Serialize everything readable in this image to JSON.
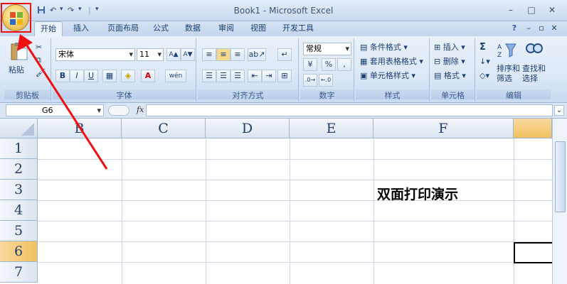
{
  "window": {
    "title": "Book1 - Microsoft Excel"
  },
  "quick_access": {
    "undo": "↶",
    "redo": "↷",
    "separator": "|",
    "more": "▾"
  },
  "window_controls": {
    "minimize": "–",
    "maximize": "□",
    "close": "✕"
  },
  "tabs": [
    {
      "label": "开始",
      "active": true
    },
    {
      "label": "插入"
    },
    {
      "label": "页面布局"
    },
    {
      "label": "公式"
    },
    {
      "label": "数据"
    },
    {
      "label": "审阅"
    },
    {
      "label": "视图"
    },
    {
      "label": "开发工具"
    }
  ],
  "ribbon_controls": {
    "help": "?",
    "minimize": "–",
    "restore": "▫",
    "close": "✕"
  },
  "ribbon": {
    "clipboard": {
      "paste": "粘贴",
      "label": "剪贴板"
    },
    "font": {
      "name": "宋体",
      "size": "11",
      "grow": "A▲",
      "shrink": "A▼",
      "bold": "B",
      "italic": "I",
      "underline": "U",
      "wen": "wén",
      "label": "字体"
    },
    "alignment": {
      "label": "对齐方式"
    },
    "number": {
      "format": "常规",
      "percent": "%",
      "comma": ",",
      "label": "数字"
    },
    "styles": {
      "conditional": "条件格式",
      "table": "套用表格格式",
      "cell": "单元格样式",
      "label": "样式"
    },
    "cells": {
      "insert": "插入",
      "delete": "删除",
      "format": "格式",
      "label": "单元格"
    },
    "editing": {
      "sigma": "Σ",
      "sort": "排序和",
      "filter": "筛选",
      "find": "查找和",
      "select": "选择",
      "label": "编辑"
    }
  },
  "formula_bar": {
    "name_box": "G6",
    "fx": "fx",
    "value": ""
  },
  "columns": [
    "B",
    "C",
    "D",
    "E",
    "F"
  ],
  "rows": [
    "1",
    "2",
    "3",
    "4",
    "5",
    "6",
    "7"
  ],
  "cells": {
    "F3": "双面打印演示"
  },
  "active_cell": "G6",
  "colors": {
    "accent": "#e11",
    "selected_header": "#f1c15f"
  }
}
